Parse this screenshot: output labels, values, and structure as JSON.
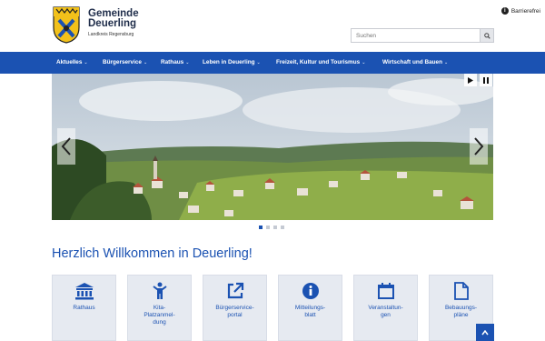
{
  "header": {
    "site_name_line1": "Gemeinde",
    "site_name_line2": "Deuerling",
    "site_subtitle": "Landkreis Regensburg",
    "accessibility_label": "Barrierefrei"
  },
  "search": {
    "placeholder": "Suchen",
    "value": ""
  },
  "nav": {
    "items": [
      {
        "label": "Aktuelles"
      },
      {
        "label": "Bürgerservice"
      },
      {
        "label": "Rathaus"
      },
      {
        "label": "Leben in Deuerling"
      },
      {
        "label": "Freizeit, Kultur und Tourismus"
      },
      {
        "label": "Wirtschaft und Bauen"
      }
    ]
  },
  "slider": {
    "slide_count": 4,
    "active_slide": 1
  },
  "main": {
    "welcome_heading": "Herzlich Willkommen in Deuerling!"
  },
  "tiles": [
    {
      "label": "Rathaus",
      "icon": "building-columns-icon"
    },
    {
      "label": "Kita-\nPlatzanmel-\ndung",
      "icon": "child-icon"
    },
    {
      "label": "Bürgerservice-\nportal",
      "icon": "external-link-icon"
    },
    {
      "label": "Mitteilungs-\nblatt",
      "icon": "info-circle-icon"
    },
    {
      "label": "Veranstaltun-\ngen",
      "icon": "calendar-icon"
    },
    {
      "label": "Bebauungs-\npläne",
      "icon": "document-icon"
    }
  ],
  "colors": {
    "primary": "#1b52b2",
    "tile_bg": "#e6eaf1"
  }
}
